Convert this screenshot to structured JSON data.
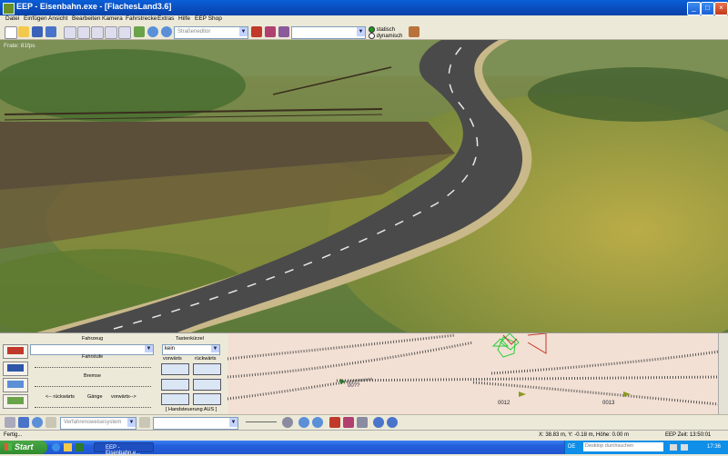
{
  "window": {
    "title": "EEP - Eisenbahn.exe - [FlachesLand3.6]"
  },
  "menu": [
    "Datei",
    "Einfügen",
    "Ansicht",
    "Bearbeiten",
    "Kamera",
    "Fahrstrecke",
    "Extras",
    "Hilfe",
    "EEP Shop"
  ],
  "toolbar": {
    "editor_combo": "Straßeneditor",
    "mode_radio": {
      "statisch": "statisch",
      "dynamisch": "dynamisch",
      "selected": "statisch"
    }
  },
  "view": {
    "fps": "Frate: 81fps"
  },
  "control_panel": {
    "fahrzeug_label": "Fahrzeug",
    "tastenkuerzel_label": "Tastenkürzel",
    "tastenkuerzel_value": "kein",
    "fahrstufe_label": "Fahrstufe",
    "vorwaerts_label": "vorwärts",
    "rueckwaerts_label": "rückwärts",
    "bremse_label": "Bremse",
    "rueckwaerts_arrow": "<-- rückwärts",
    "gaenge_label": "Gänge",
    "vorwaerts_arrow": "vorwärts-->",
    "handsteuerung": "[ Handsteuerung AUS ]"
  },
  "track_plan": {
    "labels": [
      "00??",
      "0012",
      "0013"
    ]
  },
  "bottom_toolbar": {
    "verfahren_combo": "Verfahrensweisesystem"
  },
  "status": {
    "left": "Fertig...",
    "coords": "X: 38.83 m, Y: -0.18 m, Höhe: 0.00 m",
    "time": "EEP Zeit: 13:50:01"
  },
  "taskbar": {
    "start": "Start",
    "task": "EEP - Eisenbahn.e...",
    "lang": "DE",
    "search_placeholder": "Desktop durchsuchen",
    "clock": "17:36"
  },
  "colors": {
    "title_blue": "#0b4fc0",
    "start_green": "#3a9a37",
    "taskbar_blue": "#245edb",
    "plan_bg": "#f3e0d4"
  }
}
